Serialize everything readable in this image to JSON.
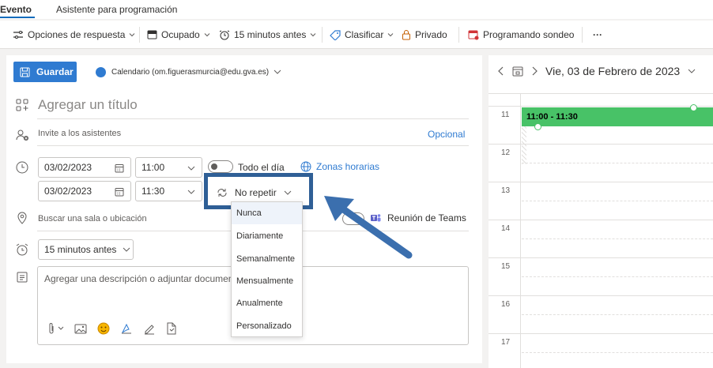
{
  "tabs": {
    "event": "Evento",
    "schedule": "Asistente para programación"
  },
  "toolbar": {
    "response_options": "Opciones de respuesta",
    "busy": "Ocupado",
    "reminder": "15 minutos antes",
    "categorize": "Clasificar",
    "private": "Privado",
    "poll": "Programando sondeo",
    "more": "···"
  },
  "form": {
    "save": "Guardar",
    "calendar": "Calendario (om.figuerasmurcia@edu.gva.es)",
    "title_placeholder": "Agregar un título",
    "attendees_placeholder": "Invite a los asistentes",
    "optional": "Opcional",
    "start_date": "03/02/2023",
    "start_time": "11:00",
    "end_date": "03/02/2023",
    "end_time": "11:30",
    "all_day": "Todo el día",
    "time_zones": "Zonas horarias",
    "repeat": "No repetir",
    "location_placeholder": "Buscar una sala o ubicación",
    "teams": "Reunión de Teams",
    "reminder": "15 minutos antes",
    "description_placeholder": "Agregar una descripción o adjuntar documento"
  },
  "repeat_options": [
    "Nunca",
    "Diariamente",
    "Semanalmente",
    "Mensualmente",
    "Anualmente",
    "Personalizado"
  ],
  "calendar": {
    "date": "Vie, 03 de Febrero de 2023",
    "hours": [
      "11",
      "12",
      "13",
      "14",
      "15",
      "16",
      "17"
    ],
    "event_time": "11:00 - 11:30"
  },
  "colors": {
    "accent": "#2f7bd1",
    "event": "#48c267",
    "highlight_box": "#2f5f96"
  }
}
